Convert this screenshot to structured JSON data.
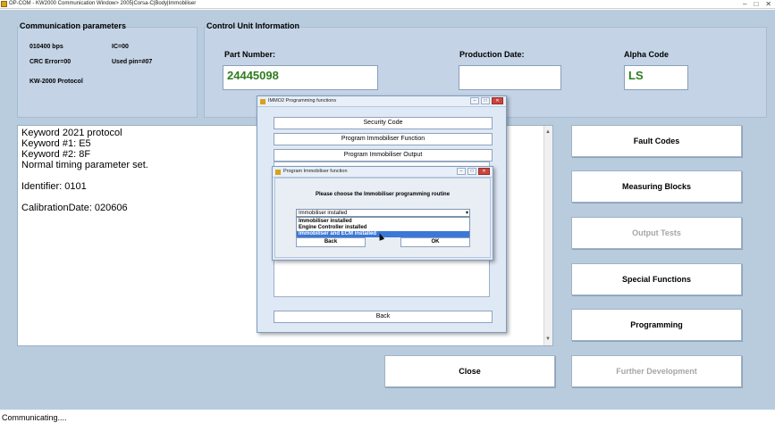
{
  "window": {
    "title": "OP-COM - KW2000 Communication Window> 2005|Corsa-C|Body|Immobiliser",
    "controls": [
      "–",
      "□",
      "✕"
    ]
  },
  "comm_params": {
    "title": "Communication parameters",
    "baud": "010400 bps",
    "ic": "IC=00",
    "crc": "CRC Error=00",
    "used_pin": "Used pin=#07",
    "protocol": "KW-2000 Protocol"
  },
  "control_unit": {
    "title": "Control Unit Information",
    "part_number_label": "Part Number:",
    "part_number": "24445098",
    "production_date_label": "Production Date:",
    "production_date": "",
    "alpha_code_label": "Alpha Code",
    "alpha_code": "LS"
  },
  "log": {
    "lines": [
      "Keyword 2021 protocol",
      "Keyword #1: E5",
      "Keyword #2: 8F",
      "Normal timing parameter set.",
      "",
      "Identifier: 0101",
      "",
      "CalibrationDate: 020606"
    ]
  },
  "right_buttons": {
    "fault_codes": "Fault Codes",
    "measuring_blocks": "Measuring Blocks",
    "output_tests": "Output Tests",
    "special_functions": "Special Functions",
    "programming": "Programming",
    "further_development": "Further Development"
  },
  "close_button": "Close",
  "status": "Communicating....",
  "immo_dialog": {
    "title": "IMMO2 Programming functions",
    "btn_security_code": "Security Code",
    "btn_program_immobiliser_function": "Program Immobiliser Function",
    "btn_program_immobiliser_output": "Program Immobiliser Output",
    "btn_back": "Back"
  },
  "sub_dialog": {
    "title": "Program Immobiliser function",
    "prompt": "Please choose the Immobiliser programming routine",
    "selected_value": "Immobiliser installed",
    "options": [
      "Immobiliser installed",
      "Engine Controller installed",
      "Immobiliser and ECM installed"
    ],
    "highlighted_index": 2,
    "back_label": "Back",
    "ok_label": "OK"
  },
  "colors": {
    "client_bg": "#b8ccde",
    "group_bg": "#c4d3e6",
    "field_text": "#2e7d1e",
    "highlight": "#3b78d8",
    "disabled_text": "#a6a6a6"
  }
}
